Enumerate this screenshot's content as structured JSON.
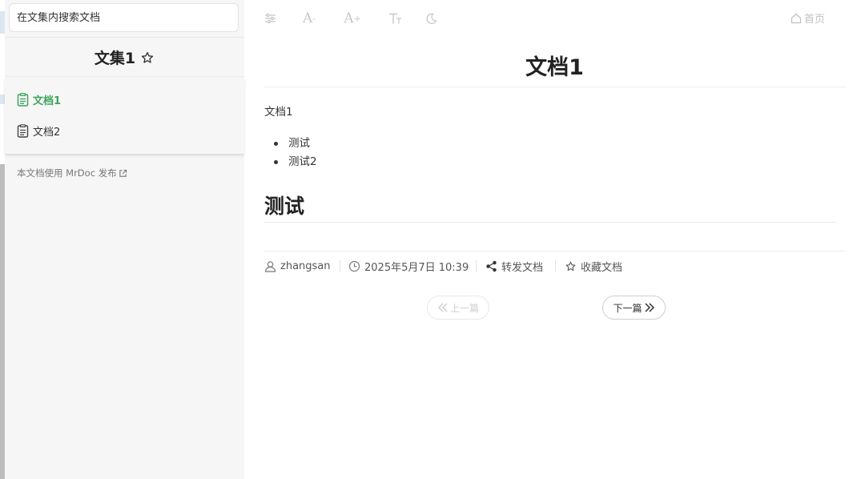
{
  "sidebar": {
    "search_placeholder": "在文集内搜索文档",
    "book_title": "文集1",
    "docs": [
      {
        "label": "文档1",
        "active": true
      },
      {
        "label": "文档2",
        "active": false
      }
    ],
    "powered_by": "本文档使用 MrDoc 发布"
  },
  "toolbar": {
    "font_decrease": "A",
    "font_decrease_mark": "-",
    "font_increase": "A",
    "font_increase_mark": "+",
    "home_label": "首页"
  },
  "doc": {
    "title": "文档1",
    "paragraph": "文档1",
    "bullets": [
      "测试",
      "测试2"
    ],
    "heading": "测试"
  },
  "meta": {
    "author": "zhangsan",
    "date": "2025年5月7日 10:39",
    "share_label": "转发文档",
    "collect_label": "收藏文档"
  },
  "pager": {
    "prev_label": "上一篇",
    "next_label": "下一篇"
  },
  "colors": {
    "accent": "#3da35a",
    "sidebar_bg": "#f6f6f6",
    "toolbar_icon": "#c8c8c8"
  }
}
